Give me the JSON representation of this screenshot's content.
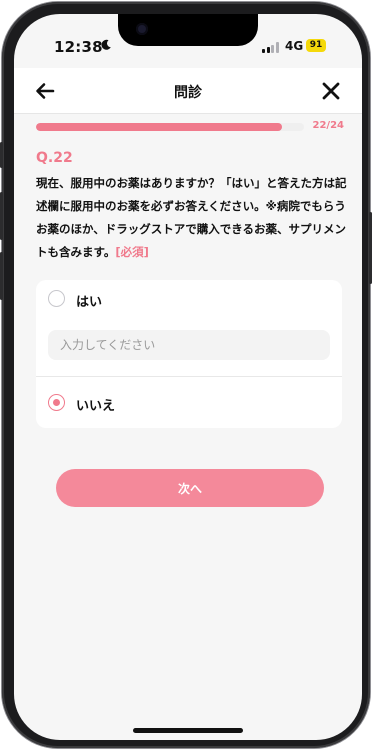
{
  "status_bar": {
    "time": "12:38",
    "network": "4G",
    "battery": "91"
  },
  "header": {
    "title": "問診",
    "back_icon": "arrow-left-icon",
    "close_icon": "close-icon"
  },
  "progress": {
    "value": 0.917,
    "label": "22/24"
  },
  "question": {
    "number": "Q.22",
    "text": "現在、服用中のお薬はありますか？「はい」と答えた方は記述欄に服用中のお薬を必ずお答えください。※病院でもらうお薬のほか、ドラッグストアで購入できるお薬、サプリメントも含みます。",
    "required_label": "[必須]"
  },
  "options": [
    {
      "label": "はい",
      "selected": false
    },
    {
      "label": "いいえ",
      "selected": true
    }
  ],
  "input": {
    "placeholder": "入力してください",
    "value": ""
  },
  "next_button": {
    "label": "次へ"
  },
  "colors": {
    "accent": "#f07a8c",
    "button": "#f4899a",
    "battery": "#f5d90a"
  }
}
